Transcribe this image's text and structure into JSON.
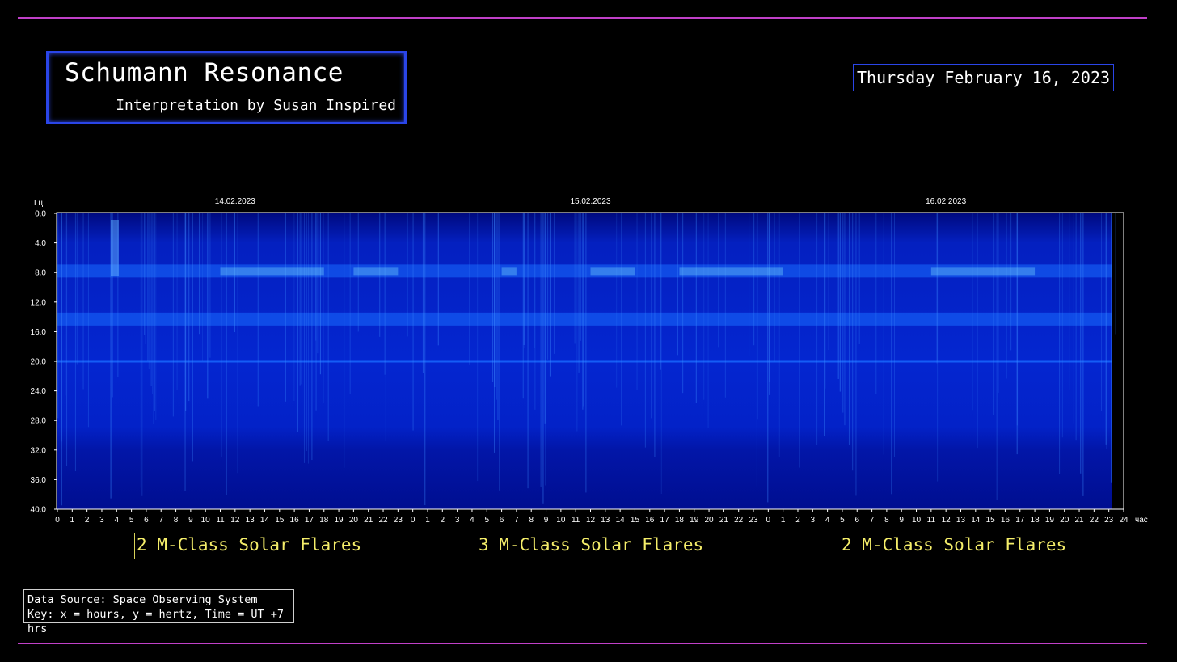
{
  "header": {
    "title": "Schumann Resonance",
    "subtitle": "Interpretation by Susan Inspired",
    "date": "Thursday February 16, 2023"
  },
  "annotations": {
    "flares": [
      "2 M-Class Solar Flares",
      "3 M-Class Solar Flares",
      "2 M-Class Solar Flares"
    ]
  },
  "footer": {
    "source_line": "Data Source: Space Observing System",
    "key_line": "Key: x = hours, y = hertz, Time = UT +7 hrs"
  },
  "colors": {
    "rule": "#c040c8",
    "title_border": "#2a45e8",
    "flare_text": "#f5ee6a",
    "spectrogram_base": "#0010a0",
    "spectrogram_band": "#1a6bff",
    "spectrogram_peak": "#7de0ff"
  },
  "chart_data": {
    "type": "heatmap",
    "ylabel": "Гц",
    "xlabel": "час",
    "date_labels": [
      "14.02.2023",
      "15.02.2023",
      "16.02.2023"
    ],
    "y_ticks": [
      "0.0",
      "4.0",
      "8.0",
      "12.0",
      "16.0",
      "20.0",
      "24.0",
      "28.0",
      "32.0",
      "36.0",
      "40.0"
    ],
    "ylim": [
      0,
      40
    ],
    "x_ticks": [
      "0",
      "1",
      "2",
      "3",
      "4",
      "5",
      "6",
      "7",
      "8",
      "9",
      "10",
      "11",
      "12",
      "13",
      "14",
      "15",
      "16",
      "17",
      "18",
      "19",
      "20",
      "21",
      "22",
      "23",
      "0",
      "1",
      "2",
      "3",
      "4",
      "5",
      "6",
      "7",
      "8",
      "9",
      "10",
      "11",
      "12",
      "13",
      "14",
      "15",
      "16",
      "17",
      "18",
      "19",
      "20",
      "21",
      "22",
      "23",
      "0",
      "1",
      "2",
      "3",
      "4",
      "5",
      "6",
      "7",
      "8",
      "9",
      "10",
      "11",
      "12",
      "13",
      "14",
      "15",
      "16",
      "17",
      "18",
      "19",
      "20",
      "21",
      "22",
      "23",
      "24"
    ],
    "xlim": [
      0,
      72
    ],
    "bands_hz": [
      7.8,
      14.3,
      20.0
    ],
    "grid": false
  }
}
